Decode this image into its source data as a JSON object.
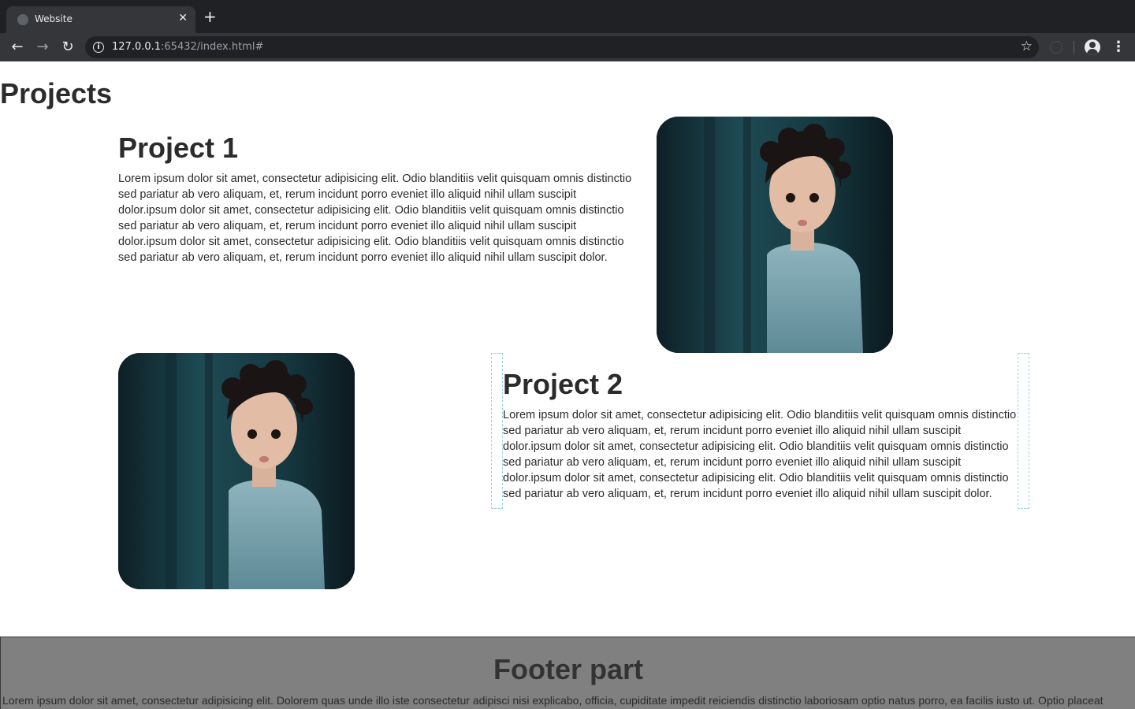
{
  "browser": {
    "tab_title": "Website",
    "tab_close": "✕",
    "new_tab": "+",
    "url_host": "127.0.0.1",
    "url_rest": ":65432/index.html#",
    "icons": [
      "globe-icon",
      "close-icon",
      "plus-icon",
      "back-icon",
      "forward-icon",
      "reload-icon",
      "info-icon",
      "star-icon",
      "extension-icon",
      "profile-icon",
      "menu-icon"
    ]
  },
  "page": {
    "heading": "Projects"
  },
  "projects": [
    {
      "title": "Project 1",
      "description": "Lorem ipsum dolor sit amet, consectetur adipisicing elit. Odio blanditiis velit quisquam omnis distinctio sed pariatur ab vero aliquam, et, rerum incidunt porro eveniet illo aliquid nihil ullam suscipit dolor.ipsum dolor sit amet, consectetur adipisicing elit. Odio blanditiis velit quisquam omnis distinctio sed pariatur ab vero aliquam, et, rerum incidunt porro eveniet illo aliquid nihil ullam suscipit dolor.ipsum dolor sit amet, consectetur adipisicing elit. Odio blanditiis velit quisquam omnis distinctio sed pariatur ab vero aliquam, et, rerum incidunt porro eveniet illo aliquid nihil ullam suscipit dolor."
    },
    {
      "title": "Project 2",
      "description": "Lorem ipsum dolor sit amet, consectetur adipisicing elit. Odio blanditiis velit quisquam omnis distinctio sed pariatur ab vero aliquam, et, rerum incidunt porro eveniet illo aliquid nihil ullam suscipit dolor.ipsum dolor sit amet, consectetur adipisicing elit. Odio blanditiis velit quisquam omnis distinctio sed pariatur ab vero aliquam, et, rerum incidunt porro eveniet illo aliquid nihil ullam suscipit dolor.ipsum dolor sit amet, consectetur adipisicing elit. Odio blanditiis velit quisquam omnis distinctio sed pariatur ab vero aliquam, et, rerum incidunt porro eveniet illo aliquid nihil ullam suscipit dolor."
    }
  ],
  "footer": {
    "title": "Footer part",
    "text": "Lorem ipsum dolor sit amet, consectetur adipisicing elit. Dolorem quas unde illo iste consectetur adipisci nisi explicabo, officia, cupiditate impedit reiciendis distinctio laboriosam optio natus porro, ea facilis iusto ut. Optio placeat"
  },
  "colors": {
    "chrome_dark": "#202124",
    "chrome_toolbar": "#35363a",
    "text": "#2b2b2b",
    "footer_bg": "#808080"
  }
}
